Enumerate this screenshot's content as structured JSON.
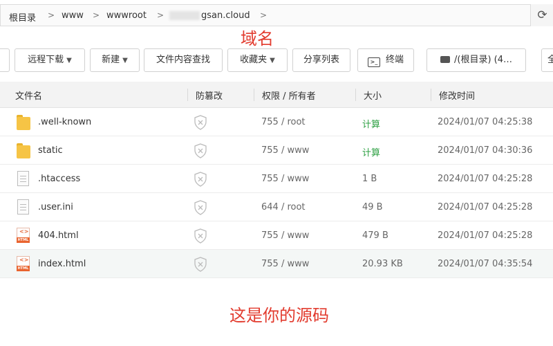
{
  "breadcrumb": [
    "根目录",
    "www",
    "wwwroot",
    "gsan.cloud"
  ],
  "annotations": {
    "domain_note": "域名",
    "source_note": "这是你的源码"
  },
  "toolbar": {
    "remote_download": "远程下载",
    "new": "新建",
    "content_search": "文件内容查找",
    "favorites": "收藏夹",
    "share_list": "分享列表",
    "terminal": "终端",
    "disk": "/(根目录) (4…"
  },
  "columns": {
    "name": "文件名",
    "tamper": "防篡改",
    "perm": "权限 / 所有者",
    "size": "大小",
    "mtime": "修改时间"
  },
  "files": [
    {
      "name": ".well-known",
      "type": "folder",
      "perm": "755 / root",
      "size": "计算",
      "mtime": "2024/01/07 04:25:38"
    },
    {
      "name": "static",
      "type": "folder",
      "perm": "755 / www",
      "size": "计算",
      "mtime": "2024/01/07 04:30:36"
    },
    {
      "name": ".htaccess",
      "type": "file",
      "perm": "755 / www",
      "size": "1 B",
      "mtime": "2024/01/07 04:25:28"
    },
    {
      "name": ".user.ini",
      "type": "file",
      "perm": "644 / root",
      "size": "49 B",
      "mtime": "2024/01/07 04:25:28"
    },
    {
      "name": "404.html",
      "type": "html",
      "perm": "755 / www",
      "size": "479 B",
      "mtime": "2024/01/07 04:25:28"
    },
    {
      "name": "index.html",
      "type": "html",
      "perm": "755 / www",
      "size": "20.93 KB",
      "mtime": "2024/01/07 04:35:54"
    }
  ],
  "icons": {
    "refresh": "refresh-icon",
    "folder": "folder-icon",
    "file": "file-icon",
    "html": "html-file-icon",
    "shield": "shield-icon",
    "terminal": "terminal-icon",
    "disk": "disk-icon"
  },
  "colors": {
    "annotation": "#e23b2e",
    "calc_link": "#2ea043",
    "html_icon": "#e9642f",
    "folder": "#f6c445"
  }
}
